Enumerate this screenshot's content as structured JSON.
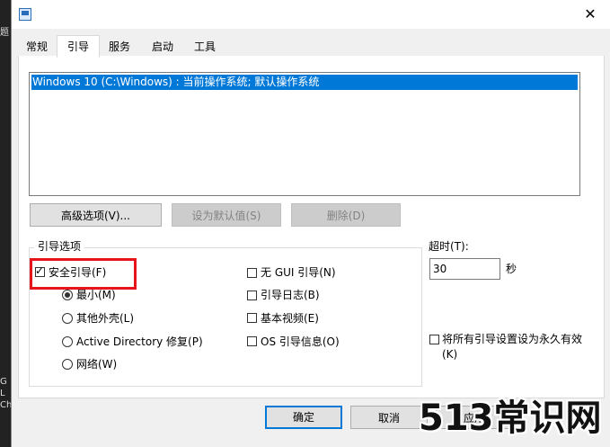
{
  "desktop": {
    "side_text": [
      "题",
      "G",
      "L",
      "Ch"
    ]
  },
  "window": {
    "close_glyph": "✕"
  },
  "tabs": [
    {
      "label": "常规"
    },
    {
      "label": "引导"
    },
    {
      "label": "服务"
    },
    {
      "label": "启动"
    },
    {
      "label": "工具"
    }
  ],
  "boot_list": {
    "items": [
      "Windows 10 (C:\\Windows) : 当前操作系统; 默认操作系统"
    ]
  },
  "buttons": {
    "advanced": "高级选项(V)...",
    "set_default": "设为默认值(S)",
    "delete": "删除(D)"
  },
  "boot_options": {
    "title": "引导选项",
    "safe_boot": {
      "label": "安全引导(F)",
      "checked": true
    },
    "radios": [
      {
        "label": "最小(M)",
        "checked": true
      },
      {
        "label": "其他外壳(L)",
        "checked": false
      },
      {
        "label": "Active Directory 修复(P)",
        "checked": false
      },
      {
        "label": "网络(W)",
        "checked": false
      }
    ],
    "checks": [
      {
        "label": "无 GUI 引导(N)",
        "checked": false
      },
      {
        "label": "引导日志(B)",
        "checked": false
      },
      {
        "label": "基本视频(E)",
        "checked": false
      },
      {
        "label": "OS 引导信息(O)",
        "checked": false
      }
    ]
  },
  "timeout": {
    "label": "超时(T):",
    "value": "30",
    "unit": "秒"
  },
  "permanent": {
    "label_line1": "将所有引导设置设为永久有效",
    "label_line2": "(K)",
    "checked": false
  },
  "footer": {
    "ok": "确定",
    "cancel": "取消",
    "apply": "应用"
  },
  "watermark": "513常识网",
  "colors": {
    "selection": "#0078d7",
    "highlight_box": "#e8141c"
  }
}
